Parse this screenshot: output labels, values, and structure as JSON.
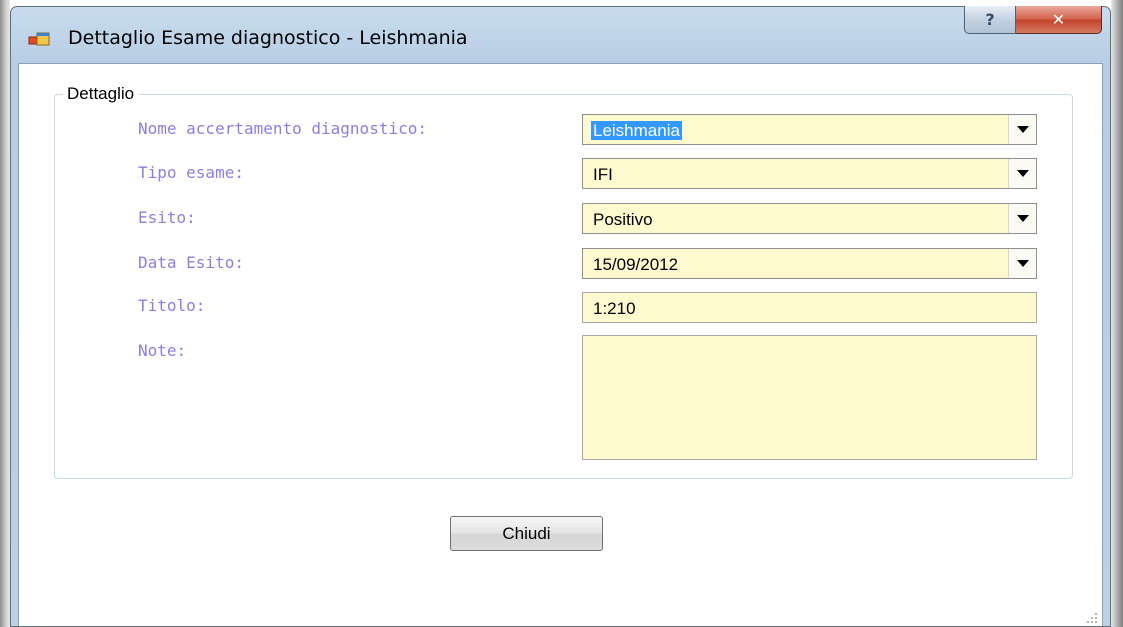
{
  "window": {
    "title": "Dettaglio Esame diagnostico - Leishmania",
    "help_label": "?",
    "close_label": "✕"
  },
  "group": {
    "legend": "Dettaglio"
  },
  "fields": {
    "nome": {
      "label": "Nome accertamento diagnostico:",
      "value": "Leishmania"
    },
    "tipo": {
      "label": "Tipo esame:",
      "value": "IFI"
    },
    "esito": {
      "label": "Esito:",
      "value": "Positivo"
    },
    "data": {
      "label": "Data Esito:",
      "value": "15/09/2012"
    },
    "titolo": {
      "label": "Titolo:",
      "value": "1:210"
    },
    "note": {
      "label": "Note:",
      "value": ""
    }
  },
  "buttons": {
    "chiudi": "Chiudi"
  },
  "icons": {
    "app": "window-app-icon",
    "dropdown": "chevron-down-icon",
    "grip": "resize-grip-icon"
  },
  "colors": {
    "label": "#8b7fe0",
    "field_background": "#fff9cf",
    "selection": "#3399ff",
    "close_button": "#c2432b"
  }
}
